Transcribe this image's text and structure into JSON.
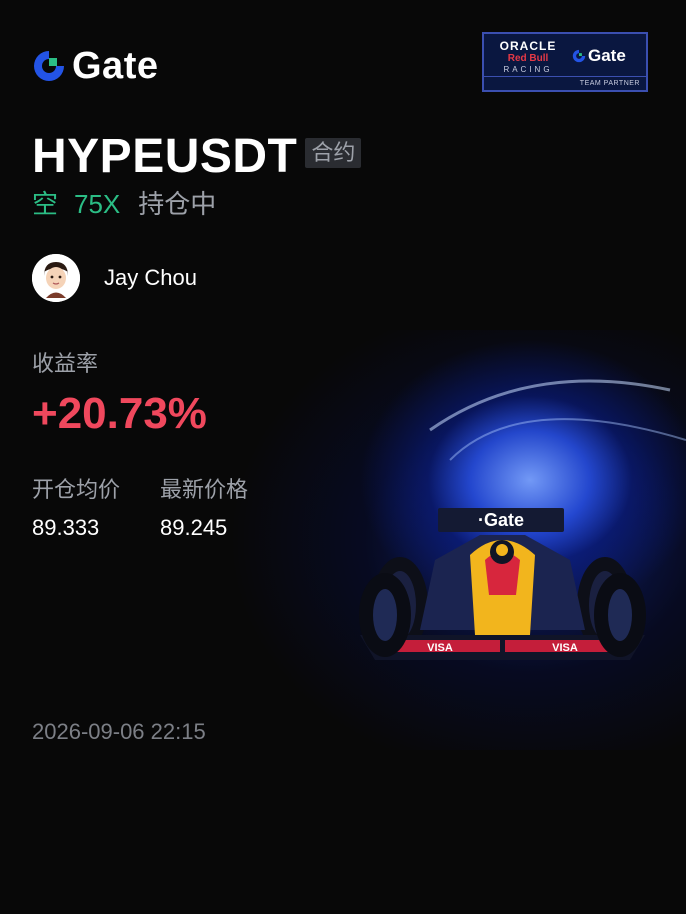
{
  "brand": {
    "name": "Gate",
    "accent": "#2354e6"
  },
  "partner_badge": {
    "line1": "ORACLE",
    "line2": "Red Bull",
    "line3": "RACING",
    "brand": "Gate",
    "caption": "TEAM PARTNER"
  },
  "position": {
    "symbol": "HYPEUSDT",
    "type_tag": "合约",
    "side": "空",
    "leverage": "75X",
    "status": "持仓中"
  },
  "user": {
    "name": "Jay Chou"
  },
  "roi": {
    "label": "收益率",
    "value": "+20.73%"
  },
  "prices": {
    "entry": {
      "label": "开仓均价",
      "value": "89.333"
    },
    "latest": {
      "label": "最新价格",
      "value": "89.245"
    }
  },
  "timestamp": "2026-09-06 22:15",
  "car_livery": "·Gate",
  "car_sponsor": "VISA",
  "colors": {
    "long_short": "#2bbd85",
    "profit": "#f0485d",
    "muted": "#9da1a9",
    "background": "#080808"
  }
}
